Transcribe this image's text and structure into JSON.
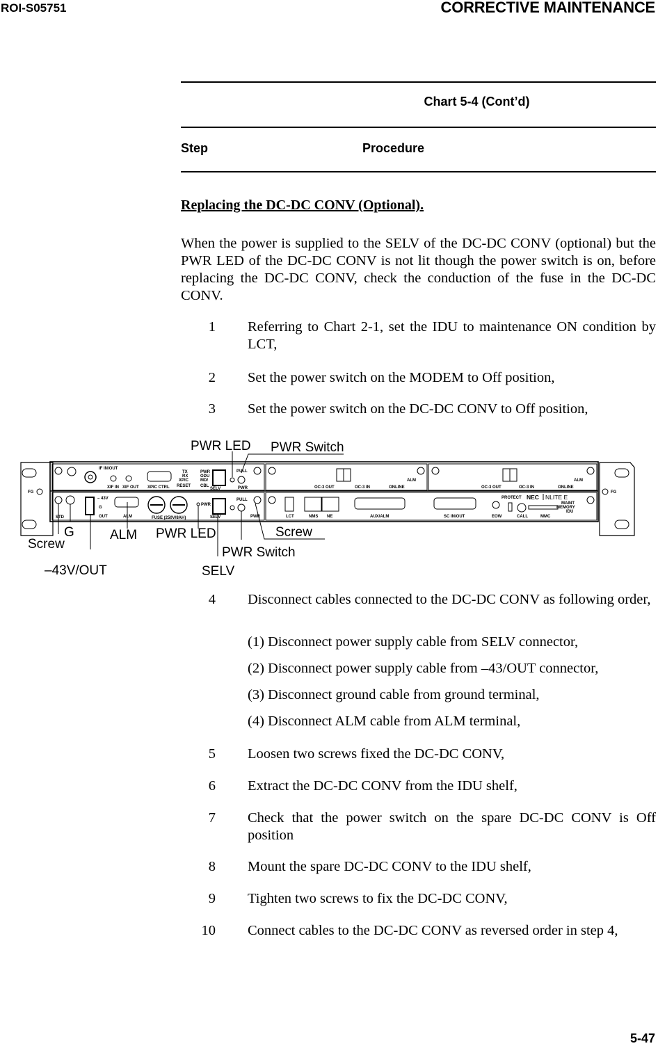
{
  "header": {
    "doc_id": "ROI-S05751",
    "section": "CORRECTIVE MAINTENANCE"
  },
  "chart": {
    "title": "Chart 5-4  (Cont’d)",
    "col_step": "Step",
    "col_procedure": "Procedure"
  },
  "section_title": "Replacing the DC-DC CONV (Optional).",
  "intro": "When the power is supplied to the SELV of the DC-DC CONV (optional) but the PWR LED of the DC-DC CONV is not lit though the power switch is on, before replacing the DC-DC CONV, check the conduction of the fuse in the DC-DC CONV.",
  "steps_before": [
    {
      "num": "1",
      "text": "Referring to Chart 2-1, set the IDU to maintenance ON condition by LCT,"
    },
    {
      "num": "2",
      "text": "Set the power switch on the MODEM to Off position,"
    },
    {
      "num": "3",
      "text": "Set the power switch on the DC-DC CONV to Off position,"
    }
  ],
  "figure": {
    "callouts": {
      "pwr_led_top": "PWR LED",
      "pwr_switch_top": "PWR Switch",
      "g": "G",
      "alm": "ALM",
      "pwr_led_bottom": "PWR LED",
      "screw_right": "Screw",
      "screw_left": "Screw",
      "pwr_switch_bottom": "PWR Switch",
      "out_43v": "–43V/OUT",
      "selv": "SELV"
    },
    "panel_labels": {
      "fg": "FG",
      "if_in_out": "IF IN/OUT",
      "xif_in": "XIF IN",
      "xif_out": "XIF OUT",
      "xpic_ctrl": "XPIC CTRL",
      "tx": "TX",
      "rx": "RX",
      "xpic": "XPIC",
      "reset": "RESET",
      "pwr": "PWR",
      "odu": "ODU",
      "md": "MD/",
      "cbl": "CBL",
      "selv": "SELV",
      "pull": "PULL",
      "std": "STD",
      "minus43v": "– 43V",
      "g": "G",
      "out": "OUT",
      "alm": "ALM",
      "fuse": "FUSE (250V/8AH)",
      "oc3_out": "OC-3 OUT",
      "oc3_in": "OC-3 IN",
      "online": "ONLINE",
      "lct": "LCT",
      "nms": "NMS",
      "ne": "NE",
      "aux_alm": "AUX/ALM",
      "sc_in_out": "SC IN/OUT",
      "eow": "EOW",
      "protect": "PROTECT",
      "call": "CALL",
      "mmc": "MMC",
      "brand": "NEC",
      "model": "NLITE E",
      "maint": "MAINT",
      "memory": "MEMORY",
      "idu": "IDU"
    }
  },
  "step4": {
    "num": "4",
    "text": "Disconnect cables connected to the DC-DC CONV as following order,",
    "subs": [
      "(1) Disconnect power supply cable from SELV connector,",
      "(2) Disconnect power supply cable from –43/OUT connector,",
      "(3) Disconnect ground cable from ground terminal,",
      "(4) Disconnect ALM cable from ALM terminal,"
    ]
  },
  "steps_after": [
    {
      "num": "5",
      "text": "Loosen two screws fixed the DC-DC CONV,"
    },
    {
      "num": "6",
      "text": "Extract the DC-DC CONV from the IDU shelf,"
    },
    {
      "num": "7",
      "text": "Check that the power switch on the spare DC-DC CONV is Off position"
    },
    {
      "num": "8",
      "text": "Mount the spare DC-DC CONV to the IDU shelf,"
    },
    {
      "num": "9",
      "text": "Tighten two screws to fix the DC-DC CONV,"
    },
    {
      "num": "10",
      "text": "Connect cables to the DC-DC CONV as reversed order in step 4,"
    }
  ],
  "footer": {
    "page": "5-47"
  }
}
